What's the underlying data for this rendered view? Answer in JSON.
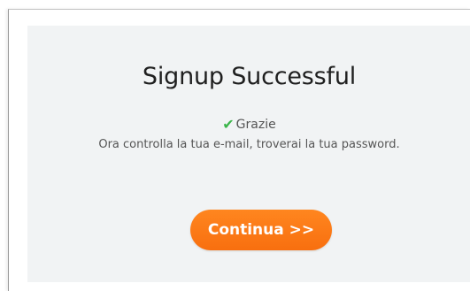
{
  "dialog": {
    "title": "Signup Successful",
    "thanks": "Grazie",
    "message": "Ora controlla la tua e-mail, troverai la tua password.",
    "continue_label": "Continua >>",
    "check_icon": "check-icon",
    "colors": {
      "accent": "#f97a16",
      "check": "#3bb54a",
      "panel_bg": "#f1f3f4"
    }
  }
}
